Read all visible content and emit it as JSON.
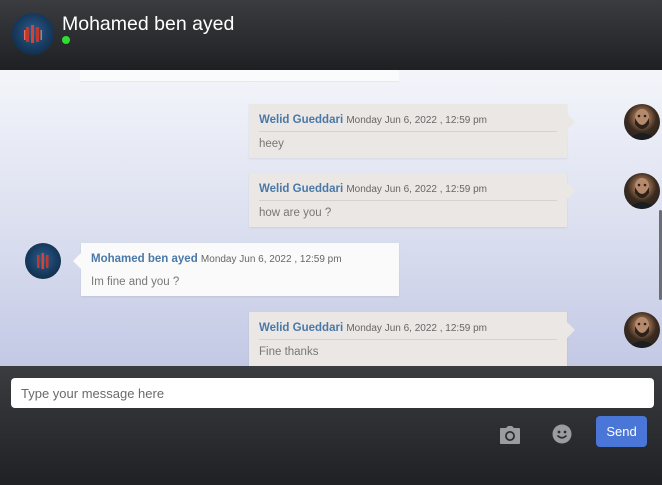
{
  "header": {
    "contact_name": "Mohamed ben ayed",
    "online_status_color": "#2ee02e"
  },
  "messages": [
    {
      "sender": "Welid Gueddari",
      "time": "Monday Jun 6, 2022 , 12:59 pm",
      "text": "heey",
      "direction": "outgoing"
    },
    {
      "sender": "Welid Gueddari",
      "time": "Monday Jun 6, 2022 , 12:59 pm",
      "text": "how are you ?",
      "direction": "outgoing"
    },
    {
      "sender": "Mohamed ben ayed",
      "time": "Monday Jun 6, 2022 , 12:59 pm",
      "text": "Im fine and you ?",
      "direction": "incoming"
    },
    {
      "sender": "Welid Gueddari",
      "time": "Monday Jun 6, 2022 , 12:59 pm",
      "text": "Fine thanks",
      "direction": "outgoing"
    }
  ],
  "composer": {
    "placeholder": "Type your message here",
    "value": "",
    "camera_icon": "camera-icon",
    "emoji_icon": "smile-icon",
    "send_label": "Send"
  },
  "colors": {
    "accent": "#4a76d8",
    "sender_name": "#4a79a8",
    "outgoing_bubble": "#ebe7e5",
    "incoming_bubble": "#fafafa"
  }
}
